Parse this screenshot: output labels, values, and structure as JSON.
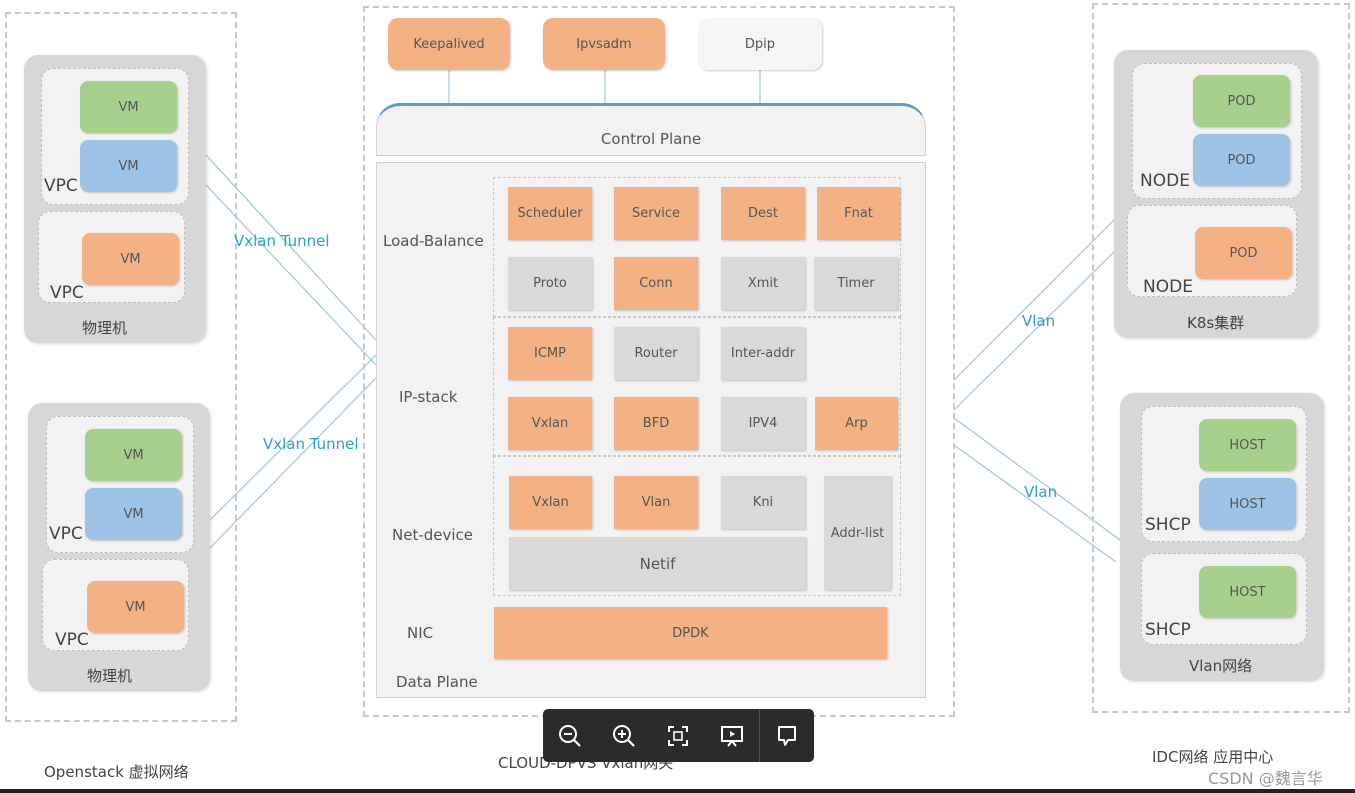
{
  "left": {
    "caption": "Openstack 虚拟网络",
    "host1": {
      "label": "物理机",
      "vpc1": "VPC",
      "vpc2": "VPC",
      "vm": [
        "VM",
        "VM",
        "VM"
      ]
    },
    "host2": {
      "label": "物理机",
      "vpc1": "VPC",
      "vpc2": "VPC",
      "vm": [
        "VM",
        "VM",
        "VM"
      ]
    },
    "tunnel1": "Vxlan Tunnel",
    "tunnel2": "Vxlan Tunnel"
  },
  "center": {
    "caption": "CLOUD-DPVS Vxlan网关",
    "top": {
      "keepalived": "Keepalived",
      "ipvsadm": "Ipvsadm",
      "dpip": "Dpip"
    },
    "control_plane": "Control Plane",
    "data_plane": "Data Plane",
    "load_balance": {
      "label": "Load-Balance",
      "items": [
        "Scheduler",
        "Service",
        "Dest",
        "Fnat",
        "Proto",
        "Conn",
        "Xmit",
        "Timer"
      ]
    },
    "ip_stack": {
      "label": "IP-stack",
      "items": [
        "ICMP",
        "Router",
        "Inter-addr",
        "Vxlan",
        "BFD",
        "IPV4",
        "Arp"
      ]
    },
    "net_device": {
      "label": "Net-device",
      "items": [
        "Vxlan",
        "Vlan",
        "Kni",
        "Addr-list",
        "Netif"
      ]
    },
    "nic": {
      "label": "NIC",
      "dpdk": "DPDK"
    }
  },
  "right": {
    "caption": "IDC网络 应用中心",
    "k8s": {
      "label": "K8s集群",
      "node1": "NODE",
      "node2": "NODE",
      "pods": [
        "POD",
        "POD",
        "POD"
      ]
    },
    "vlan_net": {
      "label": "Vlan网络",
      "shcp1": "SHCP",
      "shcp2": "SHCP",
      "hosts": [
        "HOST",
        "HOST",
        "HOST"
      ]
    },
    "vlan1": "Vlan",
    "vlan2": "Vlan"
  },
  "watermark": "CSDN @魏言华",
  "toolbar": [
    "zoom-out-icon",
    "zoom-in-icon",
    "fullscreen-icon",
    "present-icon",
    "comment-icon"
  ]
}
